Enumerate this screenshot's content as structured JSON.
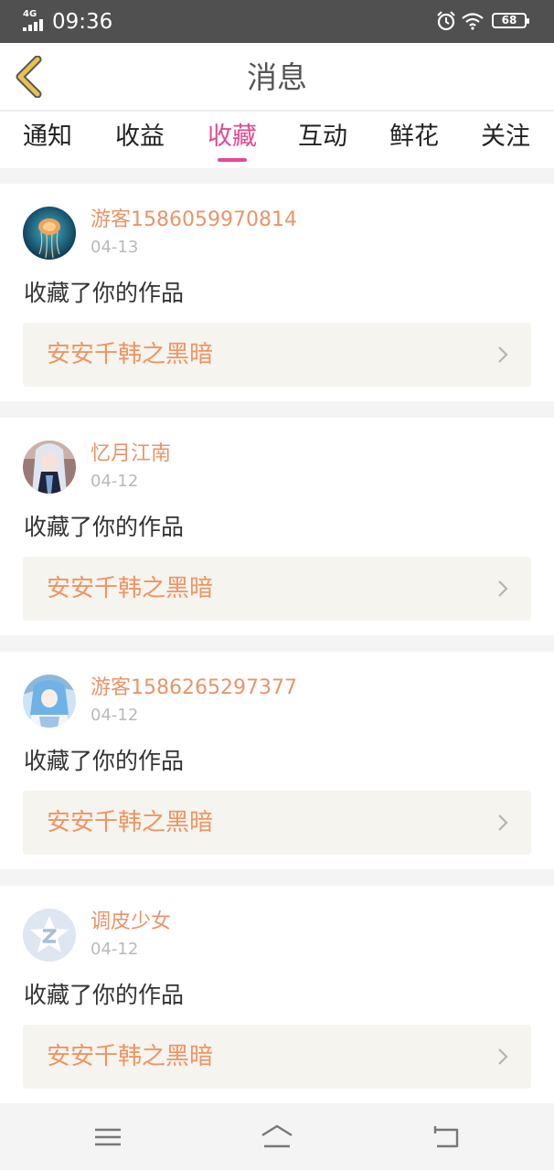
{
  "status_bar": {
    "network": "4G",
    "time": "09:36",
    "battery": "68"
  },
  "header": {
    "title": "消息"
  },
  "tabs": [
    {
      "label": "通知",
      "active": false
    },
    {
      "label": "收益",
      "active": false
    },
    {
      "label": "收藏",
      "active": true
    },
    {
      "label": "互动",
      "active": false
    },
    {
      "label": "鲜花",
      "active": false
    },
    {
      "label": "关注",
      "active": false
    }
  ],
  "messages": [
    {
      "username": "游客1586059970814",
      "date": "04-13",
      "action": "收藏了你的作品",
      "work_title": "安安千韩之黑暗"
    },
    {
      "username": "忆月江南",
      "date": "04-12",
      "action": "收藏了你的作品",
      "work_title": "安安千韩之黑暗"
    },
    {
      "username": "游客1586265297377",
      "date": "04-12",
      "action": "收藏了你的作品",
      "work_title": "安安千韩之黑暗"
    },
    {
      "username": "调皮少女",
      "date": "04-12",
      "action": "收藏了你的作品",
      "work_title": "安安千韩之黑暗"
    }
  ],
  "colors": {
    "accent": "#e24a94",
    "username": "#e8956a",
    "work_title": "#ee9563",
    "back_icon": "#d9b13c"
  }
}
